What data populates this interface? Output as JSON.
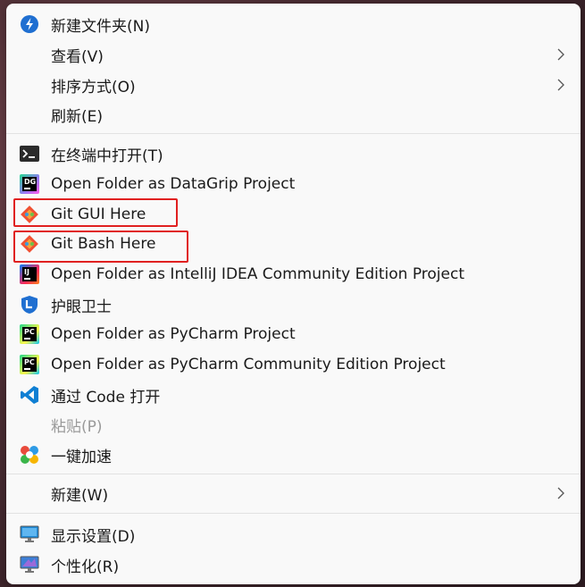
{
  "menu": {
    "items": [
      {
        "id": "new-folder",
        "label": "新建文件夹(N)"
      },
      {
        "id": "view",
        "label": "查看(V)"
      },
      {
        "id": "sort",
        "label": "排序方式(O)"
      },
      {
        "id": "refresh",
        "label": "刷新(E)"
      },
      {
        "id": "open-terminal",
        "label": "在终端中打开(T)"
      },
      {
        "id": "datagrip",
        "label": "Open Folder as DataGrip Project"
      },
      {
        "id": "git-gui",
        "label": "Git GUI Here"
      },
      {
        "id": "git-bash",
        "label": "Git Bash Here"
      },
      {
        "id": "intellij",
        "label": "Open Folder as IntelliJ IDEA Community Edition Project"
      },
      {
        "id": "eye-guard",
        "label": "护眼卫士"
      },
      {
        "id": "pycharm",
        "label": "Open Folder as PyCharm Project"
      },
      {
        "id": "pycharm-ce",
        "label": "Open Folder as PyCharm Community Edition Project"
      },
      {
        "id": "vscode",
        "label": "通过 Code 打开"
      },
      {
        "id": "paste",
        "label": "粘贴(P)"
      },
      {
        "id": "accelerate",
        "label": "一键加速"
      },
      {
        "id": "new",
        "label": "新建(W)"
      },
      {
        "id": "display-settings",
        "label": "显示设置(D)"
      },
      {
        "id": "personalize",
        "label": "个性化(R)"
      }
    ]
  },
  "icons": {
    "new-folder": "new-folder-icon",
    "open-terminal": "terminal-icon",
    "datagrip": "datagrip-icon",
    "git": "git-icon",
    "intellij": "intellij-icon",
    "eye-guard": "eye-guard-icon",
    "pycharm": "pycharm-icon",
    "vscode": "vscode-icon",
    "accelerate": "accelerate-icon",
    "display": "monitor-icon",
    "personalize": "personalize-icon",
    "submenu": "chevron-right-icon"
  },
  "colors": {
    "highlight_box": "#e02020",
    "menu_bg": "#f9f9f9",
    "disabled_text": "#9a9a9a"
  }
}
